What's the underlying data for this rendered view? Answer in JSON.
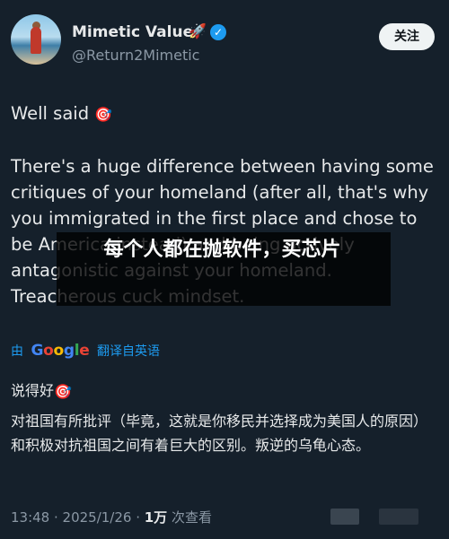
{
  "user": {
    "display_name": "Mimetic Value",
    "emoji": "🚀",
    "verified_icon": "verified-badge-icon",
    "handle": "@Return2Mimetic"
  },
  "follow_button": {
    "label": "关注"
  },
  "tweet": {
    "line1": "Well said",
    "dart_emoji": "🎯",
    "body": "There's a huge difference between having some critiques of your homeland (after all, that's why you immigrated in the first place and chose to be America instead) and being actively antagonistic against your homeland. Treacherous cuck mindset."
  },
  "overlay": {
    "text": "每个人都在抛软件，买芯片"
  },
  "translate": {
    "prefix": "由",
    "google": [
      "G",
      "o",
      "o",
      "g",
      "l",
      "e"
    ],
    "suffix": "翻译自英语"
  },
  "translation": {
    "line1": "说得好",
    "body": "对祖国有所批评（毕竟，这就是你移民并选择成为美国人的原因）和积极对抗祖国之间有着巨大的区别。叛逆的乌龟心态。"
  },
  "meta": {
    "time_date": "13:48 · 2025/1/26 · ",
    "views_count": "1万",
    "views_label": " 次查看"
  },
  "colors": {
    "background": "#15202b",
    "accent": "#1d9bf0",
    "muted": "#8b98a5"
  }
}
